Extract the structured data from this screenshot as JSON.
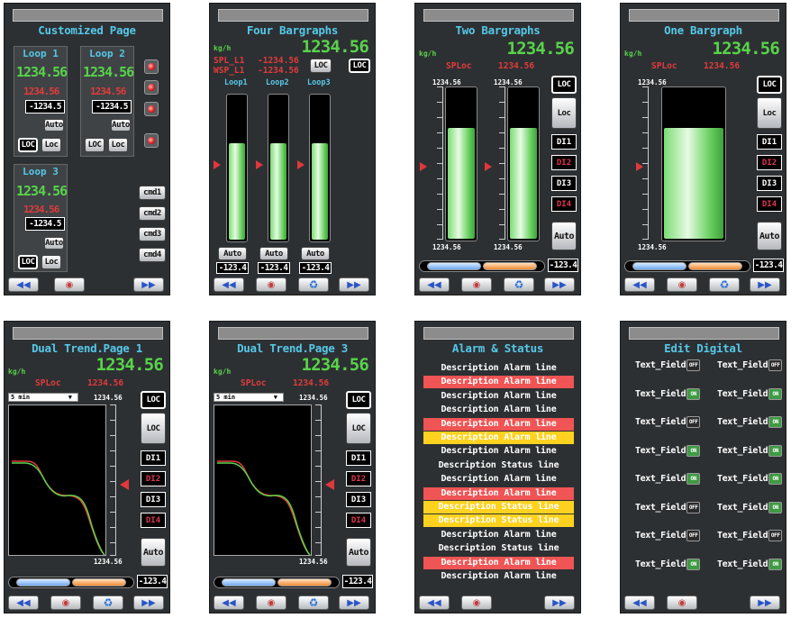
{
  "panels": {
    "customized": {
      "title": "Customized Page",
      "loop1": {
        "name": "Loop 1",
        "pv": "1234.56",
        "sp": "1234.56",
        "out": "-1234.5",
        "auto": "Auto",
        "loc1": "LOC",
        "loc2": "Loc"
      },
      "loop2": {
        "name": "Loop 2",
        "pv": "1234.56",
        "sp": "1234.56",
        "out": "-1234.5",
        "auto": "Auto",
        "loc1": "LOC",
        "loc2": "Loc"
      },
      "loop3": {
        "name": "Loop 3",
        "pv": "1234.56",
        "sp": "1234.56",
        "out": "-1234.5",
        "auto": "Auto",
        "loc1": "LOC",
        "loc2": "Loc"
      },
      "cmds": [
        "cmd1",
        "cmd2",
        "cmd3",
        "cmd4"
      ]
    },
    "four": {
      "title": "Four Bargraphs",
      "unit": "kg/h",
      "pv": "1234.56",
      "spl_label": "SPL_L1",
      "spl_value": "-1234.56",
      "wsp_label": "WSP_L1",
      "wsp_value": "-1234.56",
      "loc1": "LOC",
      "loc2": "LOC",
      "loops": [
        "Loop1",
        "Loop2",
        "Loop3"
      ],
      "levels": [
        0.68,
        0.68,
        0.68
      ],
      "auto": "Auto",
      "outs": [
        "-123.4",
        "-123.4",
        "-123.4"
      ]
    },
    "two": {
      "title": "Two Bargraphs",
      "unit": "kg/h",
      "pv": "1234.56",
      "sp_label": "SPLoc",
      "sp_value": "1234.56",
      "top_scale": [
        "1234.56",
        "1234.56"
      ],
      "bottom_scale": [
        "1234.56",
        "1234.56"
      ],
      "levels": [
        0.75,
        0.75
      ],
      "loc1": "LOC",
      "loc2": "Loc",
      "di": [
        "DI1",
        "DI2",
        "DI3",
        "DI4"
      ],
      "auto": "Auto",
      "out": "-123.4"
    },
    "one": {
      "title": "One Bargraph",
      "unit": "kg/h",
      "pv": "1234.56",
      "sp_label": "SPLoc",
      "sp_value": "1234.56",
      "top_scale": "1234.56",
      "bottom_scale": "1234.56",
      "level": 0.75,
      "loc1": "LOC",
      "loc2": "Loc",
      "di": [
        "DI1",
        "DI2",
        "DI3",
        "DI4"
      ],
      "auto": "Auto",
      "out": "-123.4"
    },
    "trend1": {
      "title": "Dual Trend.Page 1",
      "unit": "kg/h",
      "pv": "1234.56",
      "sp_label": "SPLoc",
      "sp_value": "1234.56",
      "timespan": "5 min",
      "scale_top": "1234.56",
      "scale_bottom": "1234.56",
      "loc1": "LOC",
      "loc2": "LOC",
      "di": [
        "DI1",
        "DI2",
        "DI3",
        "DI4"
      ],
      "auto": "Auto",
      "out": "-123.4"
    },
    "trend3": {
      "title": "Dual Trend.Page 3",
      "unit": "kg/h",
      "pv": "1234.56",
      "sp_label": "SPLoc",
      "sp_value": "1234.56",
      "timespan": "5 min",
      "scale_top": "1234.56",
      "scale_bottom": "1234.56",
      "loc1": "LOC",
      "loc2": "LOC",
      "di": [
        "DI1",
        "DI2",
        "DI3",
        "DI4"
      ],
      "auto": "Auto",
      "out": "-123.4"
    },
    "alarm": {
      "title": "Alarm & Status",
      "rows": [
        {
          "text": "Description Alarm line",
          "state": "normal"
        },
        {
          "text": "Description Alarm line",
          "state": "alarm"
        },
        {
          "text": "Description Alarm line",
          "state": "normal"
        },
        {
          "text": "Description Alarm line",
          "state": "normal"
        },
        {
          "text": "Description Alarm line",
          "state": "alarm"
        },
        {
          "text": "Description Alarm line",
          "state": "warning"
        },
        {
          "text": "Description Alarm line",
          "state": "normal"
        },
        {
          "text": "Description Status line",
          "state": "normal"
        },
        {
          "text": "Description Alarm line",
          "state": "normal"
        },
        {
          "text": "Description Alarm line",
          "state": "alarm"
        },
        {
          "text": "Description Status line",
          "state": "warning"
        },
        {
          "text": "Description Status line",
          "state": "warning"
        },
        {
          "text": "Description Alarm line",
          "state": "normal"
        },
        {
          "text": "Description Status line",
          "state": "normal"
        },
        {
          "text": "Description Alarm line",
          "state": "alarm"
        },
        {
          "text": "Description Alarm line",
          "state": "normal"
        }
      ]
    },
    "digital": {
      "title": "Edit Digital",
      "field_label": "Text_Field",
      "left": [
        "OFF",
        "ON",
        "OFF",
        "ON",
        "ON",
        "OFF",
        "OFF",
        "ON"
      ],
      "right": [
        "OFF",
        "ON",
        "ON",
        "ON",
        "ON",
        "ON",
        "OFF",
        "ON"
      ]
    }
  },
  "colors": {
    "alarm": "#f05454",
    "warning": "#ffd21f",
    "pv": "#58d34a",
    "sp": "#e23b3b",
    "title": "#55c8e8"
  },
  "icons": {
    "first": "skip-back-icon",
    "home": "operator-icon",
    "recycle": "recycle-icon",
    "last": "skip-forward-icon"
  }
}
